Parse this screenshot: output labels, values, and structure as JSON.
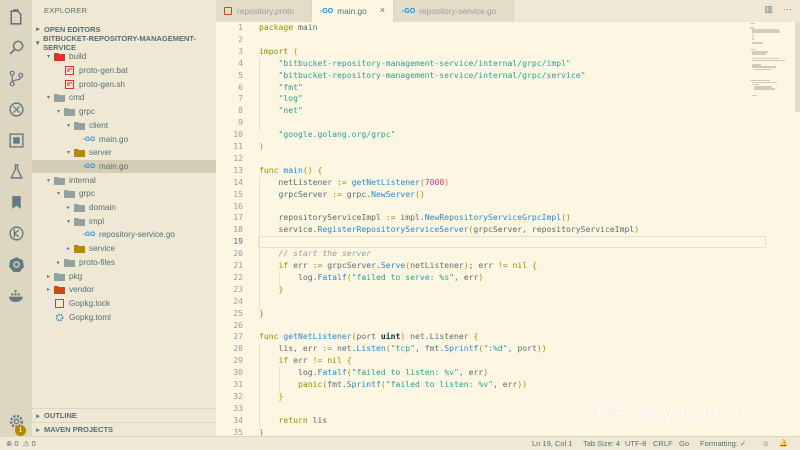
{
  "activity_bar": {
    "items": [
      {
        "name": "explorer-icon"
      },
      {
        "name": "search-icon"
      },
      {
        "name": "source-control-icon"
      },
      {
        "name": "debug-icon"
      },
      {
        "name": "extensions-icon"
      },
      {
        "name": "test-flask-icon"
      },
      {
        "name": "bookmarks-icon"
      },
      {
        "name": "git-history-icon"
      },
      {
        "name": "kubernetes-icon"
      },
      {
        "name": "docker-icon"
      }
    ],
    "settings_badge": "1"
  },
  "sidebar": {
    "title": "EXPLORER",
    "open_editors": "OPEN EDITORS",
    "project": "BITBUCKET-REPOSITORY-MANAGEMENT-SERVICE",
    "tree": [
      {
        "label": "build",
        "twisty": "▾",
        "icon": "folder-icon",
        "depth": 1
      },
      {
        "label": "proto-gen.bat",
        "icon": "script-icon",
        "depth": 2
      },
      {
        "label": "proto-gen.sh",
        "icon": "script-icon",
        "depth": 2
      },
      {
        "label": "cmd",
        "twisty": "▾",
        "icon": "folder-icon",
        "depth": 1
      },
      {
        "label": "grpc",
        "twisty": "▾",
        "icon": "folder-icon",
        "depth": 2
      },
      {
        "label": "client",
        "twisty": "▾",
        "icon": "folder-icon",
        "depth": 3
      },
      {
        "label": "main.go",
        "icon": "go-file-icon",
        "depth": 4
      },
      {
        "label": "server",
        "twisty": "▾",
        "icon": "folder-icon",
        "depth": 3
      },
      {
        "label": "main.go",
        "icon": "go-file-icon",
        "depth": 4,
        "active": true
      },
      {
        "label": "internal",
        "twisty": "▾",
        "icon": "folder-icon",
        "depth": 1
      },
      {
        "label": "grpc",
        "twisty": "▾",
        "icon": "folder-icon",
        "depth": 2
      },
      {
        "label": "domain",
        "twisty": "▸",
        "icon": "folder-icon",
        "depth": 3
      },
      {
        "label": "impl",
        "twisty": "▾",
        "icon": "folder-icon",
        "depth": 3
      },
      {
        "label": "repository-service.go",
        "icon": "go-file-icon",
        "depth": 4
      },
      {
        "label": "service",
        "twisty": "▸",
        "icon": "folder-icon",
        "depth": 3
      },
      {
        "label": "proto-files",
        "twisty": "▸",
        "icon": "folder-icon",
        "depth": 2
      },
      {
        "label": "pkg",
        "twisty": "▸",
        "icon": "folder-icon",
        "depth": 1
      },
      {
        "label": "vendor",
        "twisty": "▸",
        "icon": "folder-icon",
        "depth": 1
      },
      {
        "label": "Gopkg.lock",
        "icon": "lock-file-icon",
        "depth": 1
      },
      {
        "label": "Gopkg.toml",
        "icon": "gear-file-icon",
        "depth": 1
      }
    ],
    "outline": "OUTLINE",
    "maven": "MAVEN PROJECTS"
  },
  "tabs": [
    {
      "label": "repository.proto",
      "icon": "proto-file-icon"
    },
    {
      "label": "main.go",
      "icon": "go-file-icon",
      "active": true,
      "close": "×"
    },
    {
      "label": "repository-service.go",
      "icon": "go-file-icon"
    }
  ],
  "code_lines": [
    "package main",
    "",
    "import (",
    "    \"bitbucket-repository-management-service/internal/grpc/impl\"",
    "    \"bitbucket-repository-management-service/internal/grpc/service\"",
    "    \"fmt\"",
    "    \"log\"",
    "    \"net\"",
    "",
    "    \"google.golang.org/grpc\"",
    ")",
    "",
    "func main() {",
    "    netListener := getNetListener(7000)",
    "    grpcServer := grpc.NewServer()",
    "",
    "    repositoryServiceImpl := impl.NewRepositoryServiceGrpcImpl()",
    "    service.RegisterRepositoryServiceServer(grpcServer, repositoryServiceImpl)",
    "",
    "    // start the server",
    "    if err := grpcServer.Serve(netListener); err != nil {",
    "        log.Fatalf(\"failed to serve: %s\", err)",
    "    }",
    "",
    "}",
    "",
    "func getNetListener(port uint) net.Listener {",
    "    lis, err := net.Listen(\"tcp\", fmt.Sprintf(\":%d\", port))",
    "    if err != nil {",
    "        log.Fatalf(\"failed to listen: %v\", err)",
    "        panic(fmt.Sprintf(\"failed to listen: %v\", err))",
    "    }",
    "",
    "    return lis",
    "}"
  ],
  "current_line": 19,
  "status": {
    "errors": "0",
    "warnings": "0",
    "cursor": "Ln 19, Col 1",
    "tab_size": "Tab Size: 4",
    "encoding": "UTF-8",
    "eol": "CRLF",
    "language": "Go",
    "formatting": "Formatting: ✓",
    "smile": "☺",
    "bell": "🔔"
  },
  "watermark": "知乎 @iyacontrol",
  "colors": {
    "background": "#fdf6e3",
    "sidebar": "#eee8d5",
    "activity": "#ddd6c1",
    "keyword": "#859900",
    "string": "#2aa198",
    "function": "#268bd2",
    "number": "#d33682",
    "type": "#b58900",
    "comment": "#93a1a1"
  }
}
